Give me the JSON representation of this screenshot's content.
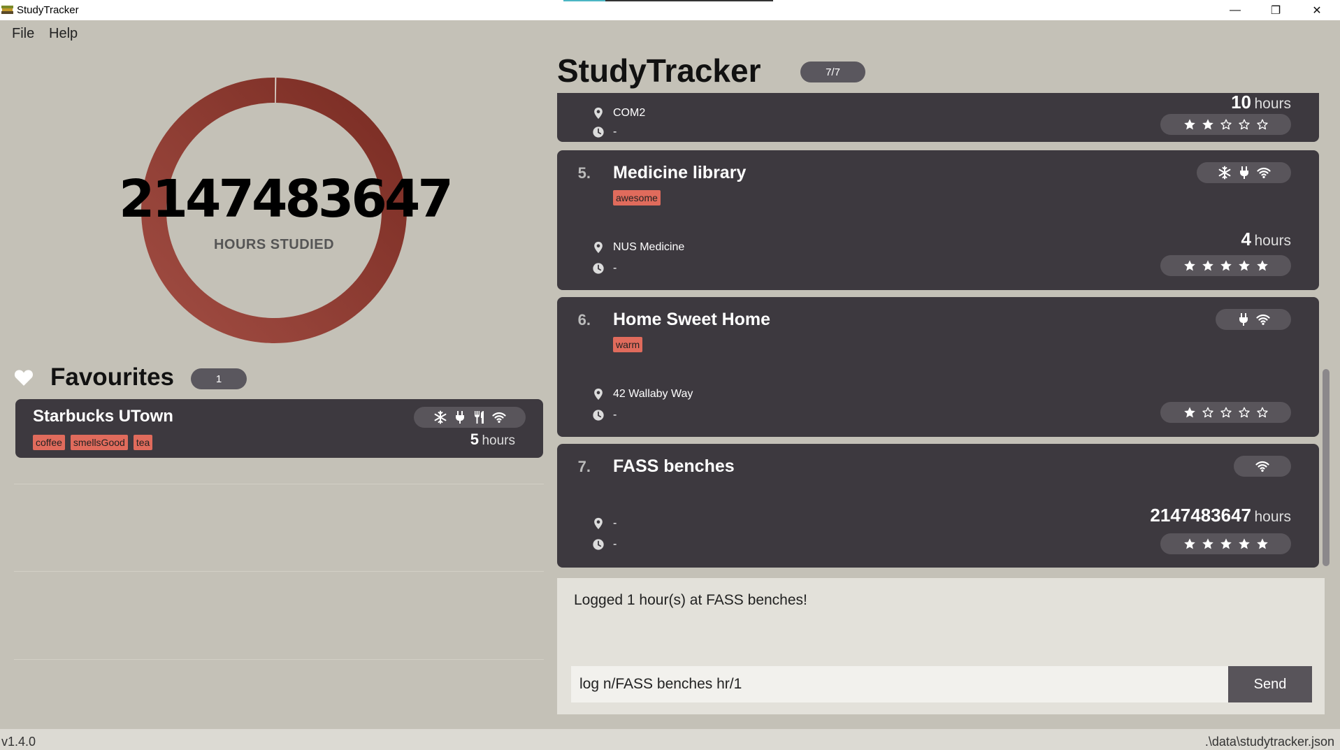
{
  "window": {
    "title": "StudyTracker",
    "controls": {
      "minimize": "—",
      "maximize": "❐",
      "close": "✕"
    }
  },
  "menu": {
    "file": "File",
    "help": "Help"
  },
  "stats": {
    "hours_value": "2147483647",
    "hours_label": "HOURS STUDIED",
    "ring_fill_fraction": 0.998
  },
  "favourites": {
    "title": "Favourites",
    "count": "1",
    "items": [
      {
        "name": "Starbucks UTown",
        "tags": [
          "coffee",
          "smellsGood",
          "tea"
        ],
        "amenities": [
          "snowflake-icon",
          "plug-icon",
          "utensils-icon",
          "wifi-icon"
        ],
        "hours_num": "5",
        "hours_unit": "hours"
      }
    ]
  },
  "main": {
    "title": "StudyTracker",
    "count": "7/7"
  },
  "spots": [
    {
      "index": "",
      "name": "",
      "tags": [],
      "location": "COM2",
      "time": "-",
      "hours_num": "10",
      "hours_unit": "hours",
      "rating": 2,
      "amenities": []
    },
    {
      "index": "5.",
      "name": "Medicine library",
      "tags": [
        "awesome"
      ],
      "location": "NUS Medicine",
      "time": "-",
      "hours_num": "4",
      "hours_unit": "hours",
      "rating": 5,
      "amenities": [
        "snowflake-icon",
        "plug-icon",
        "wifi-icon"
      ]
    },
    {
      "index": "6.",
      "name": "Home Sweet Home",
      "tags": [
        "warm"
      ],
      "location": "42 Wallaby Way",
      "time": "-",
      "hours_num": "",
      "hours_unit": "",
      "rating": 1,
      "amenities": [
        "plug-icon",
        "wifi-icon"
      ]
    },
    {
      "index": "7.",
      "name": "FASS benches",
      "tags": [],
      "location": "-",
      "time": "-",
      "hours_num": "2147483647",
      "hours_unit": "hours",
      "rating": 5,
      "amenities": [
        "wifi-icon"
      ]
    }
  ],
  "result": {
    "message": "Logged 1 hour(s) at FASS benches!"
  },
  "command": {
    "value": "log n/FASS benches hr/1",
    "send_label": "Send"
  },
  "status": {
    "version": "v1.4.0",
    "file_path": ".\\data\\studytracker.json"
  },
  "colors": {
    "background": "#c4c1b7",
    "card": "#3d393f",
    "tag": "#e06b5c",
    "ring_light": "#9b4a40",
    "ring_dark": "#7e2f25"
  }
}
